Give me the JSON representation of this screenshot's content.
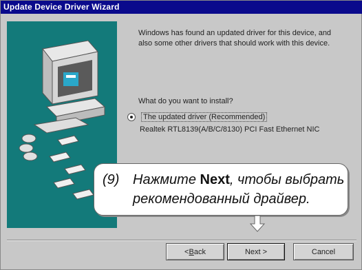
{
  "window": {
    "title": "Update Device Driver Wizard"
  },
  "message": {
    "line1": "Windows has found an updated driver for this device, and",
    "line2": "also some other drivers that should work with this device."
  },
  "question": "What do you want to install?",
  "option": {
    "label": "The updated driver (Recommended)",
    "detail": "Realtek RTL8139(A/B/C/8130) PCI Fast Ethernet NIC"
  },
  "callout": {
    "step": "(9)",
    "line1_pre": "Нажмите",
    "line1_bold": "Next",
    "line1_post": ", чтобы выбрать",
    "line2": "рекомендованный драйвер."
  },
  "buttons": {
    "back_pre": "< ",
    "back_mnemonic": "B",
    "back_post": "ack",
    "next": "Next >",
    "cancel": "Cancel"
  },
  "colors": {
    "titlebar": "#0a0a8c",
    "illustration_bg": "#137a7a",
    "dialog_bg": "#c8c8c8"
  }
}
